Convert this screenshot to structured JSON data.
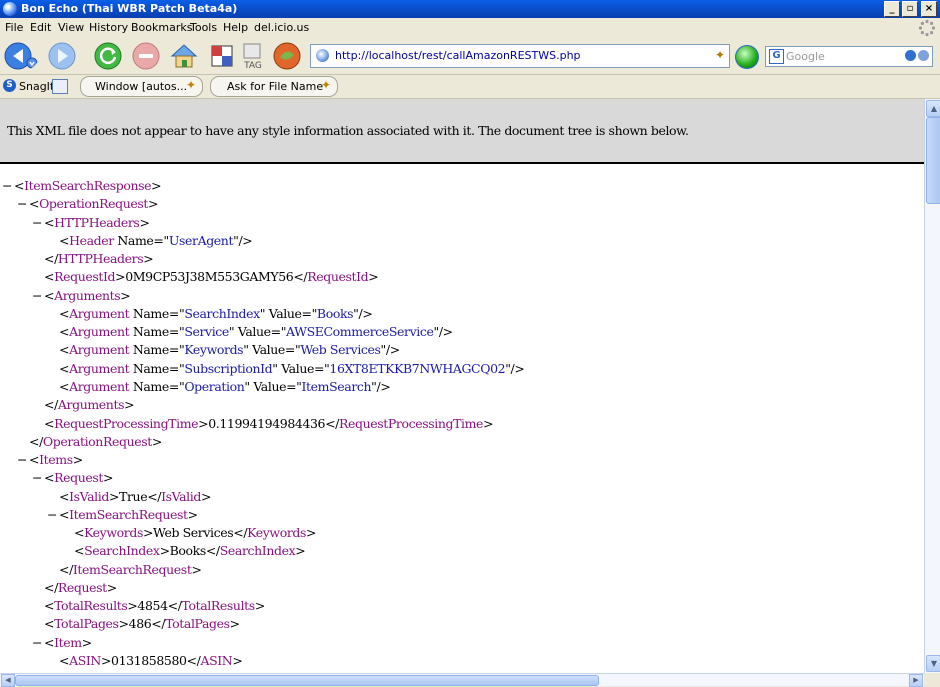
{
  "window": {
    "title": "Bon Echo (Thai WBR Patch Beta4a)",
    "controls": {
      "minimize": "_",
      "maximize": "▫",
      "close": "×"
    }
  },
  "menu": [
    "File",
    "Edit",
    "View",
    "History",
    "Bookmarks",
    "Tools",
    "Help",
    "del.icio.us"
  ],
  "nav": {
    "url": "http://localhost/rest/callAmazonRESTWS.php",
    "tag_label": "TAG",
    "search_placeholder": "Google"
  },
  "extensions": {
    "snagit_label": "SnagIt",
    "pill1": "Window [autos...",
    "pill2": "Ask for File Name"
  },
  "xml_notice": "This XML file does not appear to have any style information associated with it. The document tree is shown below.",
  "xml_lines": [
    {
      "d": 0,
      "col": "−",
      "p": [
        [
          "t",
          "<"
        ],
        [
          "g",
          "ItemSearchResponse"
        ],
        [
          "t",
          ">"
        ]
      ]
    },
    {
      "d": 1,
      "col": "−",
      "p": [
        [
          "t",
          "<"
        ],
        [
          "g",
          "OperationRequest"
        ],
        [
          "t",
          ">"
        ]
      ]
    },
    {
      "d": 2,
      "col": "−",
      "p": [
        [
          "t",
          "<"
        ],
        [
          "g",
          "HTTPHeaders"
        ],
        [
          "t",
          ">"
        ]
      ]
    },
    {
      "d": 3,
      "col": "",
      "p": [
        [
          "t",
          "<"
        ],
        [
          "g",
          "Header"
        ],
        [
          "t",
          " Name=\""
        ],
        [
          "v",
          "UserAgent"
        ],
        [
          "t",
          "\"/>"
        ]
      ]
    },
    {
      "d": 2,
      "col": "",
      "p": [
        [
          "t",
          "</"
        ],
        [
          "g",
          "HTTPHeaders"
        ],
        [
          "t",
          ">"
        ]
      ]
    },
    {
      "d": 2,
      "col": "",
      "p": [
        [
          "t",
          "<"
        ],
        [
          "g",
          "RequestId"
        ],
        [
          "t",
          ">0M9CP53J38M553GAMY56</"
        ],
        [
          "g",
          "RequestId"
        ],
        [
          "t",
          ">"
        ]
      ]
    },
    {
      "d": 2,
      "col": "−",
      "p": [
        [
          "t",
          "<"
        ],
        [
          "g",
          "Arguments"
        ],
        [
          "t",
          ">"
        ]
      ]
    },
    {
      "d": 3,
      "col": "",
      "p": [
        [
          "t",
          "<"
        ],
        [
          "g",
          "Argument"
        ],
        [
          "t",
          " Name=\""
        ],
        [
          "v",
          "SearchIndex"
        ],
        [
          "t",
          "\" Value=\""
        ],
        [
          "v",
          "Books"
        ],
        [
          "t",
          "\"/>"
        ]
      ]
    },
    {
      "d": 3,
      "col": "",
      "p": [
        [
          "t",
          "<"
        ],
        [
          "g",
          "Argument"
        ],
        [
          "t",
          " Name=\""
        ],
        [
          "v",
          "Service"
        ],
        [
          "t",
          "\" Value=\""
        ],
        [
          "v",
          "AWSECommerceService"
        ],
        [
          "t",
          "\"/>"
        ]
      ]
    },
    {
      "d": 3,
      "col": "",
      "p": [
        [
          "t",
          "<"
        ],
        [
          "g",
          "Argument"
        ],
        [
          "t",
          " Name=\""
        ],
        [
          "v",
          "Keywords"
        ],
        [
          "t",
          "\" Value=\""
        ],
        [
          "v",
          "Web Services"
        ],
        [
          "t",
          "\"/>"
        ]
      ]
    },
    {
      "d": 3,
      "col": "",
      "p": [
        [
          "t",
          "<"
        ],
        [
          "g",
          "Argument"
        ],
        [
          "t",
          " Name=\""
        ],
        [
          "v",
          "SubscriptionId"
        ],
        [
          "t",
          "\" Value=\""
        ],
        [
          "v",
          "16XT8ETKKB7NWHAGCQ02"
        ],
        [
          "t",
          "\"/>"
        ]
      ]
    },
    {
      "d": 3,
      "col": "",
      "p": [
        [
          "t",
          "<"
        ],
        [
          "g",
          "Argument"
        ],
        [
          "t",
          " Name=\""
        ],
        [
          "v",
          "Operation"
        ],
        [
          "t",
          "\" Value=\""
        ],
        [
          "v",
          "ItemSearch"
        ],
        [
          "t",
          "\"/>"
        ]
      ]
    },
    {
      "d": 2,
      "col": "",
      "p": [
        [
          "t",
          "</"
        ],
        [
          "g",
          "Arguments"
        ],
        [
          "t",
          ">"
        ]
      ]
    },
    {
      "d": 2,
      "col": "",
      "p": [
        [
          "t",
          "<"
        ],
        [
          "g",
          "RequestProcessingTime"
        ],
        [
          "t",
          ">0.11994194984436</"
        ],
        [
          "g",
          "RequestProcessingTime"
        ],
        [
          "t",
          ">"
        ]
      ]
    },
    {
      "d": 1,
      "col": "",
      "p": [
        [
          "t",
          "</"
        ],
        [
          "g",
          "OperationRequest"
        ],
        [
          "t",
          ">"
        ]
      ]
    },
    {
      "d": 1,
      "col": "−",
      "p": [
        [
          "t",
          "<"
        ],
        [
          "g",
          "Items"
        ],
        [
          "t",
          ">"
        ]
      ]
    },
    {
      "d": 2,
      "col": "−",
      "p": [
        [
          "t",
          "<"
        ],
        [
          "g",
          "Request"
        ],
        [
          "t",
          ">"
        ]
      ]
    },
    {
      "d": 3,
      "col": "",
      "p": [
        [
          "t",
          "<"
        ],
        [
          "g",
          "IsValid"
        ],
        [
          "t",
          ">True</"
        ],
        [
          "g",
          "IsValid"
        ],
        [
          "t",
          ">"
        ]
      ]
    },
    {
      "d": 3,
      "col": "−",
      "p": [
        [
          "t",
          "<"
        ],
        [
          "g",
          "ItemSearchRequest"
        ],
        [
          "t",
          ">"
        ]
      ]
    },
    {
      "d": 4,
      "col": "",
      "p": [
        [
          "t",
          "<"
        ],
        [
          "g",
          "Keywords"
        ],
        [
          "t",
          ">Web Services</"
        ],
        [
          "g",
          "Keywords"
        ],
        [
          "t",
          ">"
        ]
      ]
    },
    {
      "d": 4,
      "col": "",
      "p": [
        [
          "t",
          "<"
        ],
        [
          "g",
          "SearchIndex"
        ],
        [
          "t",
          ">Books</"
        ],
        [
          "g",
          "SearchIndex"
        ],
        [
          "t",
          ">"
        ]
      ]
    },
    {
      "d": 3,
      "col": "",
      "p": [
        [
          "t",
          "</"
        ],
        [
          "g",
          "ItemSearchRequest"
        ],
        [
          "t",
          ">"
        ]
      ]
    },
    {
      "d": 2,
      "col": "",
      "p": [
        [
          "t",
          "</"
        ],
        [
          "g",
          "Request"
        ],
        [
          "t",
          ">"
        ]
      ]
    },
    {
      "d": 2,
      "col": "",
      "p": [
        [
          "t",
          "<"
        ],
        [
          "g",
          "TotalResults"
        ],
        [
          "t",
          ">4854</"
        ],
        [
          "g",
          "TotalResults"
        ],
        [
          "t",
          ">"
        ]
      ]
    },
    {
      "d": 2,
      "col": "",
      "p": [
        [
          "t",
          "<"
        ],
        [
          "g",
          "TotalPages"
        ],
        [
          "t",
          ">486</"
        ],
        [
          "g",
          "TotalPages"
        ],
        [
          "t",
          ">"
        ]
      ]
    },
    {
      "d": 2,
      "col": "−",
      "p": [
        [
          "t",
          "<"
        ],
        [
          "g",
          "Item"
        ],
        [
          "t",
          ">"
        ]
      ]
    },
    {
      "d": 3,
      "col": "",
      "p": [
        [
          "t",
          "<"
        ],
        [
          "g",
          "ASIN"
        ],
        [
          "t",
          ">0131858580</"
        ],
        [
          "g",
          "ASIN"
        ],
        [
          "t",
          ">"
        ]
      ]
    }
  ]
}
